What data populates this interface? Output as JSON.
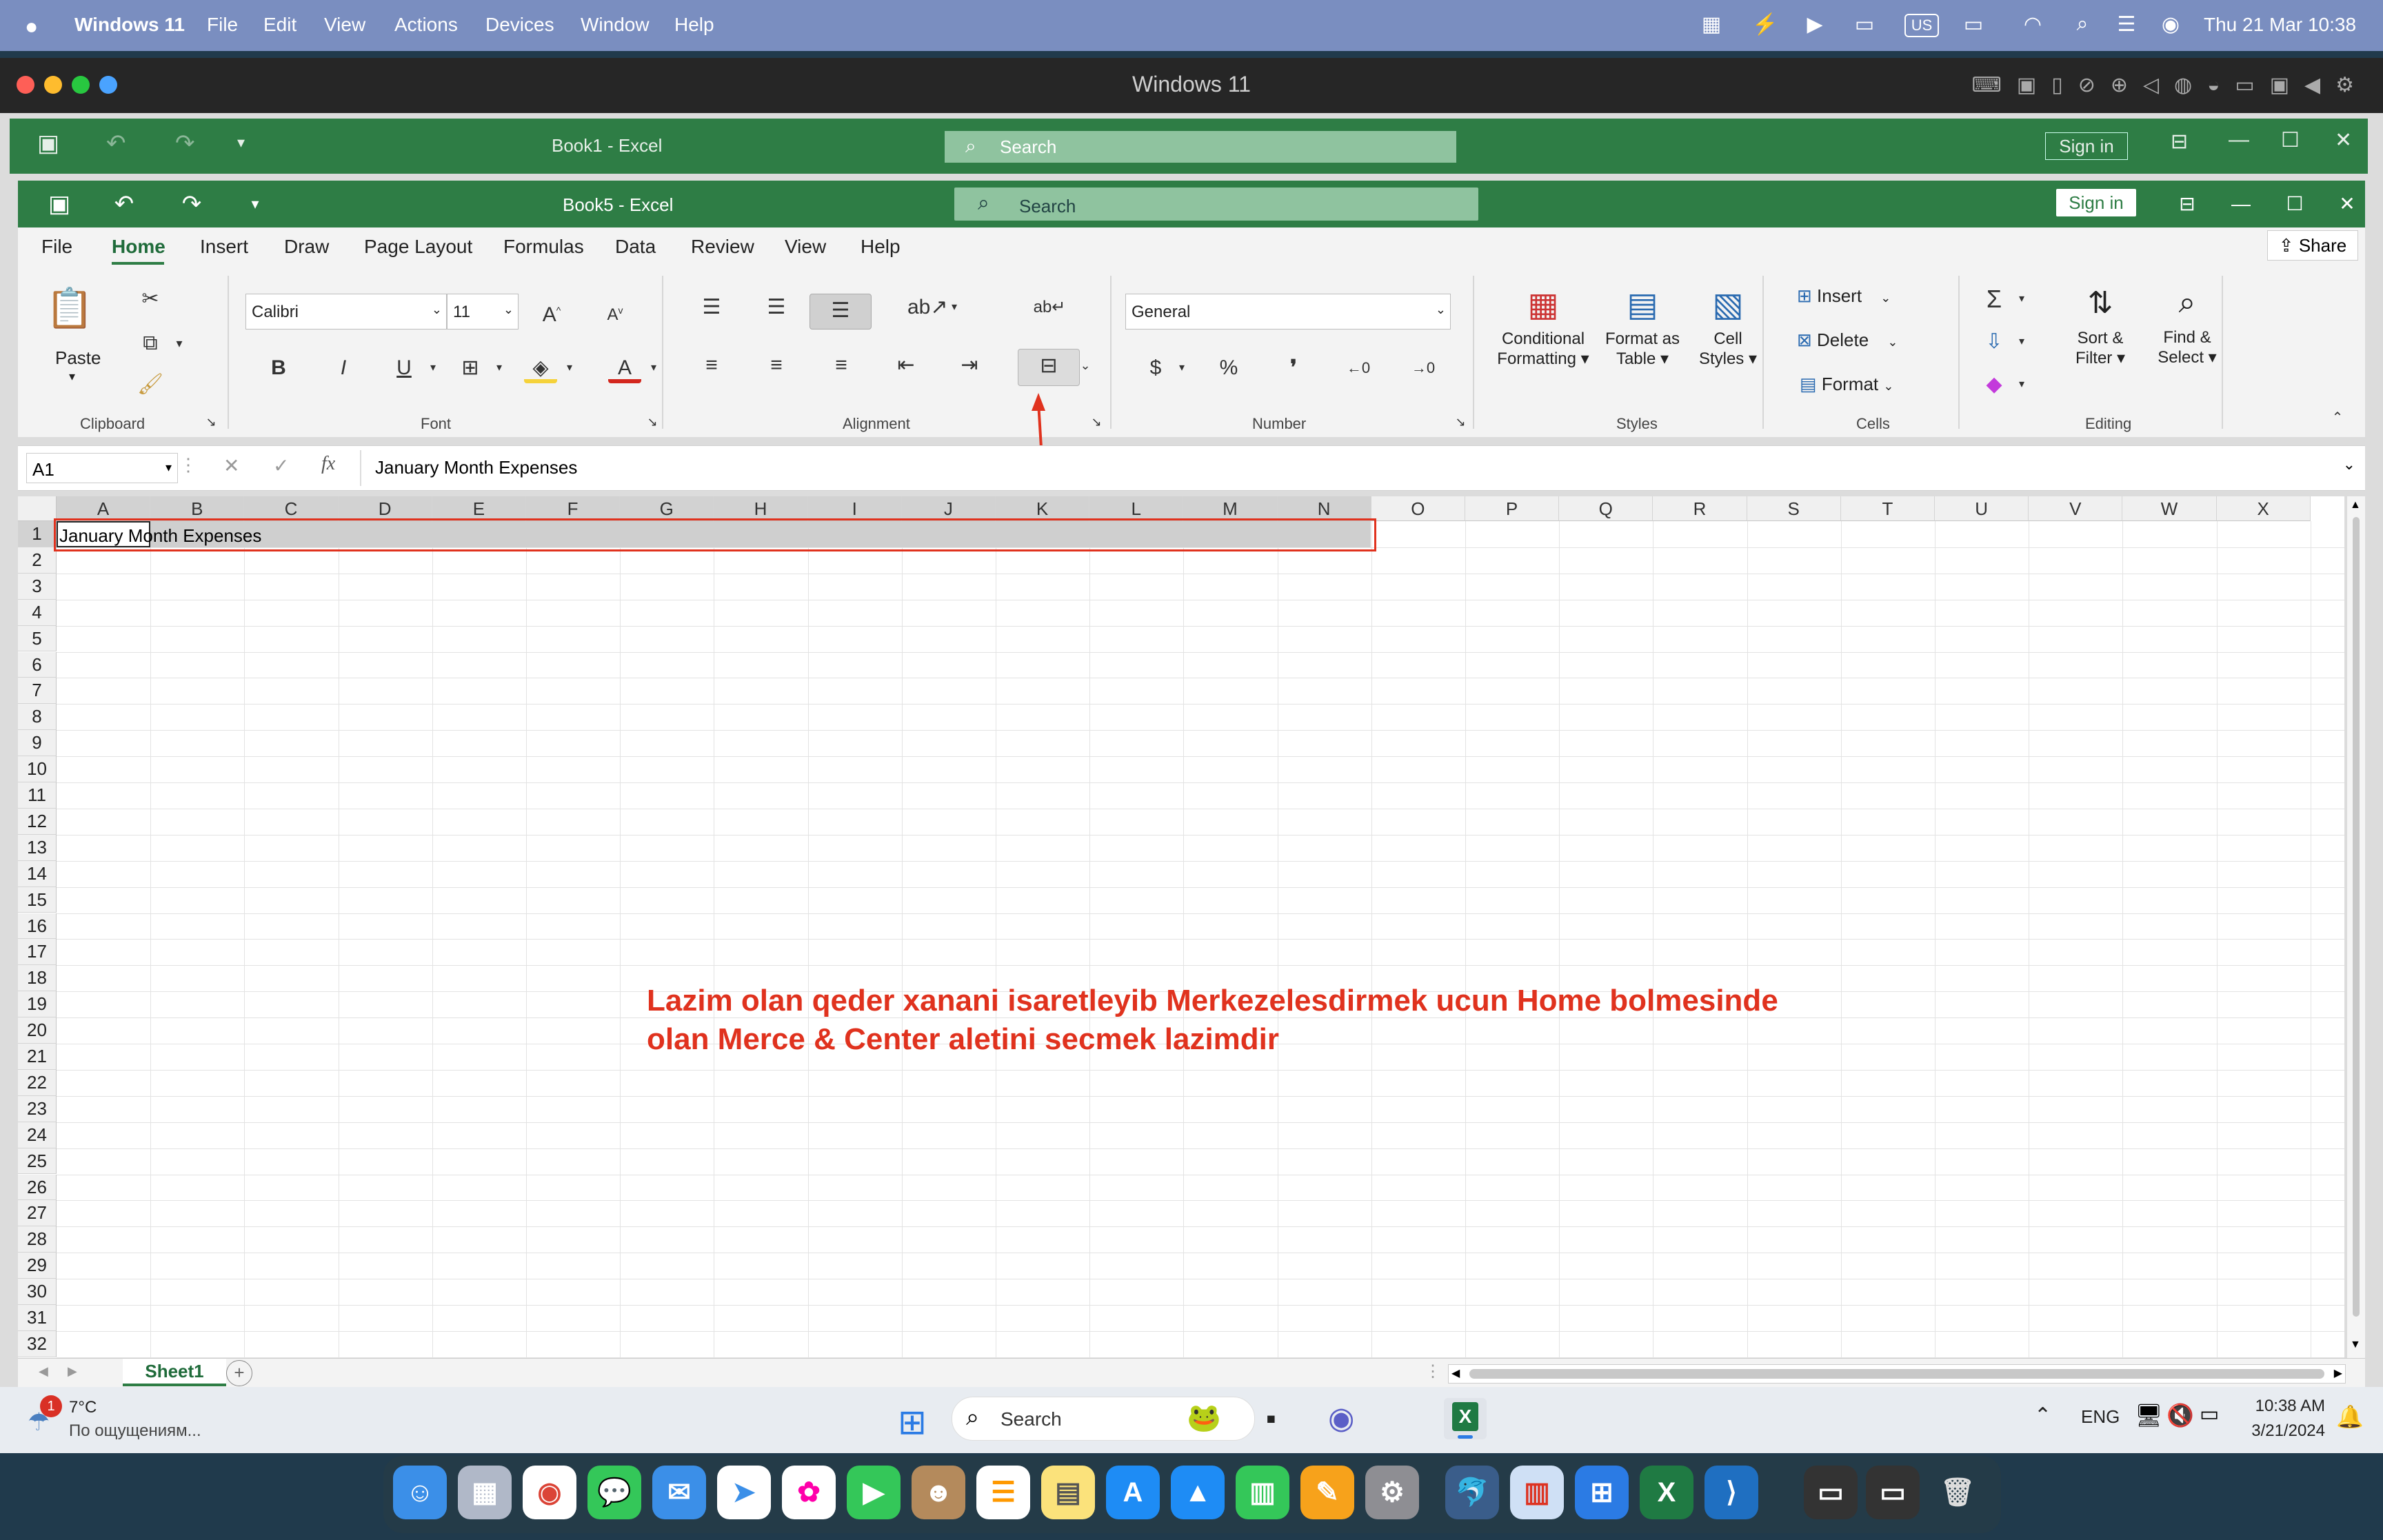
{
  "macbar": {
    "apple": "",
    "app": "Windows 11",
    "menus": [
      "File",
      "Edit",
      "View",
      "Actions",
      "Devices",
      "Window",
      "Help"
    ],
    "input": "US",
    "datetime": "Thu 21 Mar  10:38"
  },
  "parallels": {
    "title": "Windows 11"
  },
  "back_window": {
    "title": "Book1  -  Excel",
    "search": "Search",
    "signin": "Sign in"
  },
  "excel": {
    "title": "Book5  -  Excel",
    "search": "Search",
    "signin": "Sign in",
    "tabs": [
      "File",
      "Home",
      "Insert",
      "Draw",
      "Page Layout",
      "Formulas",
      "Data",
      "Review",
      "View",
      "Help"
    ],
    "share": "Share",
    "clipboard": {
      "paste": "Paste",
      "label": "Clipboard"
    },
    "font": {
      "name": "Calibri",
      "size": "11",
      "label": "Font",
      "bold": "B",
      "italic": "I",
      "underline": "U"
    },
    "alignment": {
      "label": "Alignment"
    },
    "number": {
      "format": "General",
      "label": "Number",
      "currency": "$",
      "percent": "%",
      "comma": "❜"
    },
    "styles": {
      "conditional": [
        "Conditional",
        "Formatting"
      ],
      "format_table": [
        "Format as",
        "Table"
      ],
      "cell_styles": [
        "Cell",
        "Styles"
      ],
      "label": "Styles"
    },
    "cells": {
      "insert": "Insert",
      "delete": "Delete",
      "format": "Format",
      "label": "Cells"
    },
    "editing": {
      "sort": [
        "Sort &",
        "Filter"
      ],
      "find": [
        "Find &",
        "Select"
      ],
      "label": "Editing"
    },
    "namebox": "A1",
    "fx": "fx",
    "formula": "January Month Expenses",
    "columns": [
      "A",
      "B",
      "C",
      "D",
      "E",
      "F",
      "G",
      "H",
      "I",
      "J",
      "K",
      "L",
      "M",
      "N",
      "O",
      "P",
      "Q",
      "R",
      "S",
      "T",
      "U",
      "V",
      "W",
      "X"
    ],
    "rows": [
      "1",
      "2",
      "3",
      "4",
      "5",
      "6",
      "7",
      "8",
      "9",
      "10",
      "11",
      "12",
      "13",
      "14",
      "15",
      "16",
      "17",
      "18",
      "19",
      "20",
      "21",
      "22",
      "23",
      "24",
      "25",
      "26",
      "27",
      "28",
      "29",
      "30",
      "31",
      "32"
    ],
    "cell_a1": "January Month Expenses",
    "sheet": "Sheet1"
  },
  "annotation": {
    "line1": "Lazim olan qeder xanani isaretleyib Merkezelesdirmek ucun Home bolmesinde",
    "line2": "olan Merce & Center aletini secmek lazimdir"
  },
  "taskbar": {
    "weather_badge": "1",
    "temp": "7°C",
    "weather_text": "По ощущениям...",
    "search": "Search",
    "lang": "ENG",
    "time": "10:38 AM",
    "date": "3/21/2024"
  },
  "colors": {
    "excel_green": "#2e7d45",
    "annotation_red": "#e0321e",
    "selection": "#c8c8c8"
  }
}
